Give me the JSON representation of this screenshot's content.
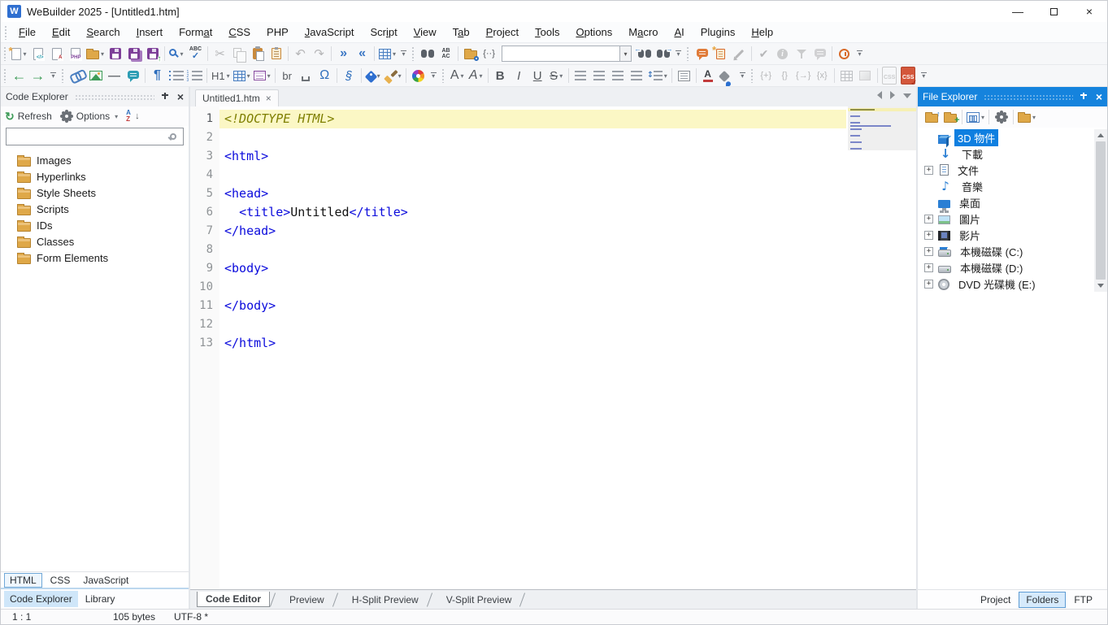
{
  "window": {
    "title": "WeBuilder 2025 - [Untitled1.htm]",
    "app_icon": "W"
  },
  "menu": [
    {
      "label": "File",
      "u": 0
    },
    {
      "label": "Edit",
      "u": 0
    },
    {
      "label": "Search",
      "u": 0
    },
    {
      "label": "Insert",
      "u": 0
    },
    {
      "label": "Format",
      "u": 4
    },
    {
      "label": "CSS",
      "u": 0
    },
    {
      "label": "PHP",
      "u": -1
    },
    {
      "label": "JavaScript",
      "u": 0
    },
    {
      "label": "Script",
      "u": 3
    },
    {
      "label": "View",
      "u": 0
    },
    {
      "label": "Tab",
      "u": 1
    },
    {
      "label": "Project",
      "u": 0
    },
    {
      "label": "Tools",
      "u": 0
    },
    {
      "label": "Options",
      "u": 0
    },
    {
      "label": "Macro",
      "u": 1
    },
    {
      "label": "AI",
      "u": 0
    },
    {
      "label": "Plugins",
      "u": -1
    },
    {
      "label": "Help",
      "u": 0
    }
  ],
  "find_combo": {
    "value": ""
  },
  "toolbar1": [
    {
      "t": "grip"
    },
    {
      "t": "i",
      "n": "new-document",
      "k": "page",
      "star": 1,
      "dd": 1
    },
    {
      "t": "i",
      "n": "new-html-document",
      "k": "page",
      "b": "</>",
      "bc": "#2a9db0"
    },
    {
      "t": "i",
      "n": "new-style-document",
      "k": "page",
      "b": "A",
      "bc": "#b3272d"
    },
    {
      "t": "i",
      "n": "new-php-document",
      "k": "page",
      "b": "PHP",
      "bc": "#7d3f98"
    },
    {
      "t": "i",
      "n": "open-file",
      "k": "folder",
      "dd": 1
    },
    {
      "t": "i",
      "n": "save",
      "k": "floppy"
    },
    {
      "t": "i",
      "n": "save-all",
      "k": "floppy",
      "v": "all"
    },
    {
      "t": "i",
      "n": "save-and-upload",
      "k": "floppy",
      "v": "up"
    },
    {
      "t": "sep"
    },
    {
      "t": "i",
      "n": "quick-search",
      "k": "mag",
      "dd": 1
    },
    {
      "t": "i",
      "n": "spell-check",
      "k": "spell"
    },
    {
      "t": "sep"
    },
    {
      "t": "i",
      "n": "cut",
      "k": "glyph",
      "g": "✂",
      "c": "#5a6068",
      "fs": 15,
      "dis": 1
    },
    {
      "t": "i",
      "n": "copy",
      "k": "copy",
      "dis": 1
    },
    {
      "t": "i",
      "n": "paste",
      "k": "paste"
    },
    {
      "t": "i",
      "n": "clipboard-viewer",
      "k": "clip"
    },
    {
      "t": "sep"
    },
    {
      "t": "i",
      "n": "undo",
      "k": "glyph",
      "g": "↶",
      "c": "#5a6068",
      "fs": 15,
      "dis": 1
    },
    {
      "t": "i",
      "n": "redo",
      "k": "glyph",
      "g": "↷",
      "c": "#5a6068",
      "fs": 15,
      "dis": 1
    },
    {
      "t": "sep"
    },
    {
      "t": "i",
      "n": "indent",
      "k": "glyph",
      "g": "»",
      "c": "#3a76c4",
      "fs": 16,
      "bold": 1
    },
    {
      "t": "i",
      "n": "outdent",
      "k": "glyph",
      "g": "«",
      "c": "#3a76c4",
      "fs": 16,
      "bold": 1
    },
    {
      "t": "sep"
    },
    {
      "t": "i",
      "n": "code-snippets",
      "k": "grid",
      "dd": 1
    },
    {
      "t": "ovf"
    },
    {
      "t": "grip"
    },
    {
      "t": "i",
      "n": "find",
      "k": "binoc"
    },
    {
      "t": "i",
      "n": "replace",
      "k": "replace"
    },
    {
      "t": "sep"
    },
    {
      "t": "i",
      "n": "find-in-files",
      "k": "folder",
      "mg": 1
    },
    {
      "t": "i",
      "n": "regex-search",
      "k": "glyph",
      "g": "{··}",
      "c": "#55595e",
      "fs": 11
    },
    {
      "t": "combo",
      "n": "search-term"
    },
    {
      "t": "i",
      "n": "find-previous",
      "k": "binoc",
      "pv": 1
    },
    {
      "t": "i",
      "n": "find-next",
      "k": "binoc",
      "nx": 1
    },
    {
      "t": "ovf"
    },
    {
      "t": "grip"
    },
    {
      "t": "i",
      "n": "ai-assistant",
      "k": "bubble",
      "c": "#e07b39"
    },
    {
      "t": "i",
      "n": "ai-script",
      "k": "scroll"
    },
    {
      "t": "i",
      "n": "annotate",
      "k": "pencil",
      "dis": 1
    },
    {
      "t": "sep"
    },
    {
      "t": "i",
      "n": "approve",
      "k": "glyph",
      "g": "✔",
      "c": "#5a6068",
      "fs": 14,
      "dis": 1
    },
    {
      "t": "i",
      "n": "details",
      "k": "info",
      "dis": 1
    },
    {
      "t": "i",
      "n": "filter",
      "k": "filter",
      "dis": 1
    },
    {
      "t": "i",
      "n": "comments",
      "k": "bubble",
      "c": "#9aa0a8",
      "dis": 1
    },
    {
      "t": "sep"
    },
    {
      "t": "i",
      "n": "local-history",
      "k": "clock"
    },
    {
      "t": "ovf"
    }
  ],
  "toolbar2": [
    {
      "t": "grip"
    },
    {
      "t": "i",
      "n": "navigate-back",
      "k": "glyph",
      "g": "←",
      "c": "#3d9b57",
      "fs": 18,
      "bold": 1
    },
    {
      "t": "i",
      "n": "navigate-forward",
      "k": "glyph",
      "g": "→",
      "c": "#3d9b57",
      "fs": 18,
      "bold": 1
    },
    {
      "t": "ovf"
    },
    {
      "t": "grip"
    },
    {
      "t": "i",
      "n": "insert-hyperlink",
      "k": "link"
    },
    {
      "t": "i",
      "n": "insert-image",
      "k": "img"
    },
    {
      "t": "i",
      "n": "insert-hr",
      "k": "glyph",
      "g": "—",
      "c": "#6e7378",
      "fs": 15,
      "bold": 1
    },
    {
      "t": "i",
      "n": "insert-comment",
      "k": "bubble",
      "c": "#2d9db4"
    },
    {
      "t": "sep"
    },
    {
      "t": "i",
      "n": "insert-paragraph",
      "k": "glyph",
      "g": "¶",
      "c": "#2f6fbd",
      "fs": 16,
      "bold": 1
    },
    {
      "t": "i",
      "n": "insert-bullet-list",
      "k": "list",
      "v": "ul"
    },
    {
      "t": "i",
      "n": "insert-numbered-list",
      "k": "list",
      "v": "ol"
    },
    {
      "t": "sep"
    },
    {
      "t": "i",
      "n": "insert-heading",
      "k": "glyph",
      "g": "H1",
      "c": "#55595e",
      "fs": 13,
      "dd": 1
    },
    {
      "t": "i",
      "n": "insert-table",
      "k": "grid",
      "dd": 1
    },
    {
      "t": "i",
      "n": "insert-form",
      "k": "form",
      "dd": 1
    },
    {
      "t": "sep"
    },
    {
      "t": "i",
      "n": "insert-br",
      "k": "glyph",
      "g": "br",
      "c": "#55595e",
      "fs": 13
    },
    {
      "t": "i",
      "n": "insert-nbsp",
      "k": "nbsp"
    },
    {
      "t": "i",
      "n": "insert-symbol",
      "k": "glyph",
      "g": "Ω",
      "c": "#2f6fbd",
      "fs": 16
    },
    {
      "t": "sep"
    },
    {
      "t": "i",
      "n": "insert-script-block",
      "k": "glyph",
      "g": "§",
      "c": "#2f6fbd",
      "fs": 15,
      "italic": 1
    },
    {
      "t": "sep"
    },
    {
      "t": "i",
      "n": "edit-tag",
      "k": "tag",
      "dd": 1
    },
    {
      "t": "i",
      "n": "format-painter",
      "k": "brush",
      "dd": 1
    },
    {
      "t": "sep"
    },
    {
      "t": "i",
      "n": "color-picker",
      "k": "wheel"
    },
    {
      "t": "ovf"
    },
    {
      "t": "grip"
    },
    {
      "t": "i",
      "n": "font-family",
      "k": "glyph",
      "g": "A",
      "c": "#55595e",
      "fs": 16,
      "dd": 1
    },
    {
      "t": "i",
      "n": "font-size",
      "k": "glyph",
      "g": "A",
      "c": "#55595e",
      "fs": 16,
      "italic": 1,
      "dd": 1
    },
    {
      "t": "sep"
    },
    {
      "t": "i",
      "n": "bold",
      "k": "glyph",
      "g": "B",
      "c": "#55595e",
      "fs": 15,
      "bold": 1
    },
    {
      "t": "i",
      "n": "italic",
      "k": "glyph",
      "g": "I",
      "c": "#55595e",
      "fs": 15,
      "italic": 1
    },
    {
      "t": "i",
      "n": "underline",
      "k": "glyph",
      "g": "U",
      "c": "#55595e",
      "fs": 15,
      "u": 1
    },
    {
      "t": "i",
      "n": "strikethrough",
      "k": "glyph",
      "g": "S",
      "c": "#55595e",
      "fs": 15,
      "strike": 1,
      "dd": 1
    },
    {
      "t": "sep"
    },
    {
      "t": "i",
      "n": "align-left",
      "k": "list",
      "v": "al"
    },
    {
      "t": "i",
      "n": "align-center",
      "k": "list",
      "v": "ac"
    },
    {
      "t": "i",
      "n": "align-right",
      "k": "list",
      "v": "ar"
    },
    {
      "t": "i",
      "n": "align-justify",
      "k": "list",
      "v": "aj"
    },
    {
      "t": "i",
      "n": "line-spacing",
      "k": "spacing",
      "dd": 1
    },
    {
      "t": "sep"
    },
    {
      "t": "i",
      "n": "text-area",
      "k": "textbox"
    },
    {
      "t": "sep"
    },
    {
      "t": "i",
      "n": "font-color",
      "k": "fontcolor"
    },
    {
      "t": "i",
      "n": "highlight-color",
      "k": "bucket"
    },
    {
      "t": "ovf"
    },
    {
      "t": "grip"
    },
    {
      "t": "i",
      "n": "tag-insert",
      "k": "glyph",
      "g": "{+}",
      "c": "#5a6068",
      "fs": 11,
      "dis": 1
    },
    {
      "t": "i",
      "n": "tag-empty",
      "k": "glyph",
      "g": "{}",
      "c": "#5a6068",
      "fs": 11,
      "dis": 1
    },
    {
      "t": "i",
      "n": "tag-navigate",
      "k": "glyph",
      "g": "{→}",
      "c": "#5a6068",
      "fs": 11,
      "dis": 1
    },
    {
      "t": "i",
      "n": "tag-remove",
      "k": "glyph",
      "g": "{x}",
      "c": "#5a6068",
      "fs": 11,
      "dis": 1
    },
    {
      "t": "sep"
    },
    {
      "t": "i",
      "n": "table-borders",
      "k": "grid",
      "dis": 1
    },
    {
      "t": "i",
      "n": "cell-shading",
      "k": "boxfill",
      "dis": 1
    },
    {
      "t": "sep"
    },
    {
      "t": "i",
      "n": "css-inspector",
      "k": "css",
      "dis": 1
    },
    {
      "t": "i",
      "n": "css-validator",
      "k": "css",
      "v": "act"
    },
    {
      "t": "ovf"
    }
  ],
  "code_explorer": {
    "title": "Code Explorer",
    "refresh_label": "Refresh",
    "options_label": "Options",
    "search_value": "",
    "items": [
      "Images",
      "Hyperlinks",
      "Style Sheets",
      "Scripts",
      "IDs",
      "Classes",
      "Form Elements"
    ],
    "doc_tabs": [
      {
        "label": "HTML",
        "active": true
      },
      {
        "label": "CSS",
        "active": false
      },
      {
        "label": "JavaScript",
        "active": false
      }
    ],
    "panel_tabs": [
      {
        "label": "Code Explorer",
        "active": true
      },
      {
        "label": "Library",
        "active": false
      }
    ]
  },
  "editor": {
    "tab": {
      "label": "Untitled1.htm",
      "close": "×"
    },
    "lines": [
      {
        "n": 1,
        "hl": true,
        "seg": [
          [
            "<!DOCTYPE HTML>",
            "doc"
          ]
        ]
      },
      {
        "n": 2,
        "seg": []
      },
      {
        "n": 3,
        "seg": [
          [
            "<html>",
            "tag"
          ]
        ]
      },
      {
        "n": 4,
        "seg": []
      },
      {
        "n": 5,
        "seg": [
          [
            "<head>",
            "tag"
          ]
        ]
      },
      {
        "n": 6,
        "seg": [
          [
            "  ",
            "txt"
          ],
          [
            "<title>",
            "tag"
          ],
          [
            "Untitled",
            "txt"
          ],
          [
            "</title>",
            "tag"
          ]
        ]
      },
      {
        "n": 7,
        "seg": [
          [
            "</head>",
            "tag"
          ]
        ]
      },
      {
        "n": 8,
        "seg": []
      },
      {
        "n": 9,
        "seg": [
          [
            "<body>",
            "tag"
          ]
        ]
      },
      {
        "n": 10,
        "seg": []
      },
      {
        "n": 11,
        "seg": [
          [
            "</body>",
            "tag"
          ]
        ]
      },
      {
        "n": 12,
        "seg": []
      },
      {
        "n": 13,
        "seg": [
          [
            "</html>",
            "tag"
          ]
        ]
      }
    ],
    "view_tabs": [
      {
        "label": "Code Editor",
        "active": true
      },
      {
        "label": "Preview"
      },
      {
        "label": "H-Split Preview"
      },
      {
        "label": "V-Split Preview"
      }
    ]
  },
  "file_explorer": {
    "title": "File Explorer",
    "toolbar": [
      {
        "t": "i",
        "n": "parent-folder",
        "k": "folder",
        "ov": "up"
      },
      {
        "t": "i",
        "n": "new-folder",
        "k": "folder",
        "ov": "plus"
      },
      {
        "t": "sep"
      },
      {
        "t": "i",
        "n": "view-mode",
        "k": "view",
        "dd": 1
      },
      {
        "t": "sep"
      },
      {
        "t": "i",
        "n": "explorer-options",
        "k": "gear"
      },
      {
        "t": "sep"
      },
      {
        "t": "i",
        "n": "folder-menu",
        "k": "folder",
        "dd": 1
      }
    ],
    "items": [
      {
        "label": "3D 物件",
        "icon": "cube",
        "selected": true
      },
      {
        "label": "下載",
        "icon": "download"
      },
      {
        "label": "文件",
        "icon": "doc",
        "exp": true
      },
      {
        "label": "音樂",
        "icon": "music"
      },
      {
        "label": "桌面",
        "icon": "desktop"
      },
      {
        "label": "圖片",
        "icon": "pic",
        "exp": true
      },
      {
        "label": "影片",
        "icon": "film",
        "exp": true
      },
      {
        "label": "本機磁碟 (C:)",
        "icon": "diskc",
        "exp": true
      },
      {
        "label": "本機磁碟 (D:)",
        "icon": "disk",
        "exp": true
      },
      {
        "label": "DVD 光碟機 (E:)",
        "icon": "dvd",
        "exp": true
      }
    ],
    "panel_tabs": [
      {
        "label": "Project"
      },
      {
        "label": "Folders",
        "active": true
      },
      {
        "label": "FTP"
      }
    ]
  },
  "status": {
    "cursor": "1 : 1",
    "size": "105 bytes",
    "encoding": "UTF-8 *"
  },
  "colors": {
    "accent": "#1583dd",
    "selection": "#0f7fe0",
    "tag_blue": "#0b0bdc",
    "doctype_olive": "#7f7f00",
    "line_highlight": "#fbf7c5"
  }
}
